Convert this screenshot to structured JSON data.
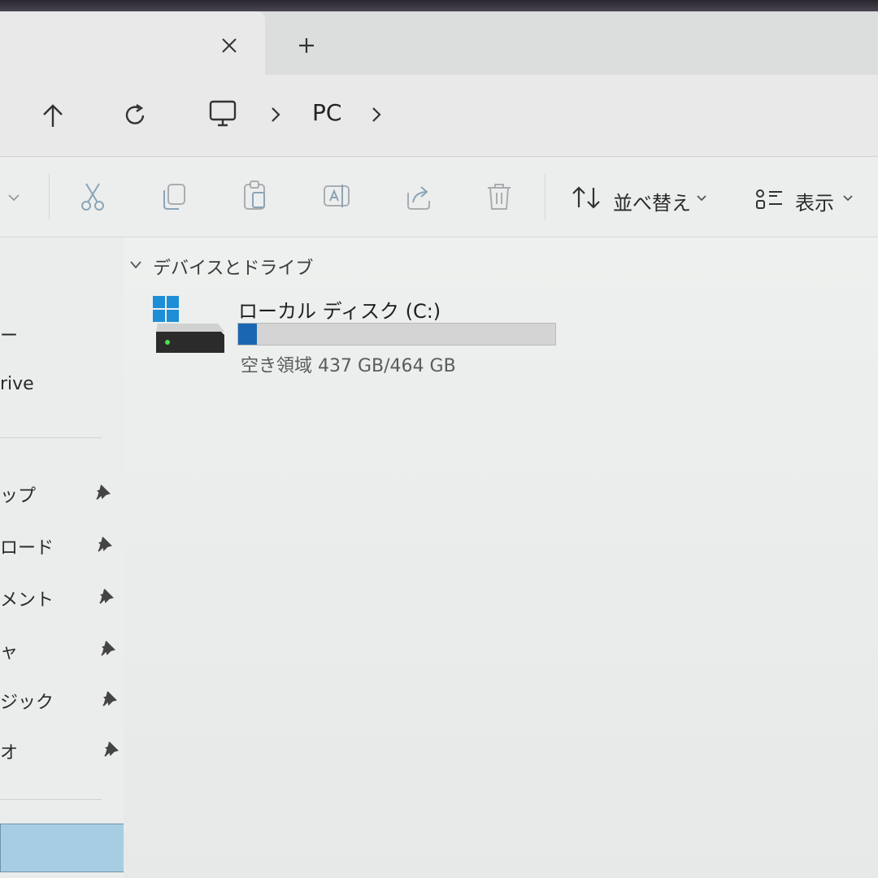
{
  "tabbar": {
    "close_icon": "close-icon",
    "new_tab_icon": "plus-icon"
  },
  "nav": {
    "up_icon": "arrow-up-icon",
    "refresh_icon": "refresh-icon",
    "pc_icon": "monitor-icon",
    "breadcrumb": [
      "PC"
    ]
  },
  "toolbar": {
    "cut_icon": "scissors-icon",
    "copy_icon": "copy-icon",
    "paste_icon": "clipboard-icon",
    "rename_icon": "rename-icon",
    "share_icon": "share-icon",
    "delete_icon": "trash-icon",
    "sort_label": "並べ替え",
    "view_label": "表示"
  },
  "sidebar": {
    "items_top": [
      {
        "label": "ー"
      },
      {
        "label": "rive"
      }
    ],
    "pinned": [
      {
        "label": "ップ"
      },
      {
        "label": "ロード"
      },
      {
        "label": "メント"
      },
      {
        "label": "ャ"
      },
      {
        "label": "ジック"
      },
      {
        "label": "オ"
      }
    ]
  },
  "main": {
    "section_title": "デバイスとドライブ",
    "drive": {
      "name": "ローカル ディスク (C:)",
      "free_text": "空き領域 437 GB/464 GB",
      "used_fraction": 0.058,
      "bar_color": "#1b66b3"
    }
  },
  "colors": {
    "accent": "#1b66b3",
    "windows_logo": "#1e8fd6"
  }
}
